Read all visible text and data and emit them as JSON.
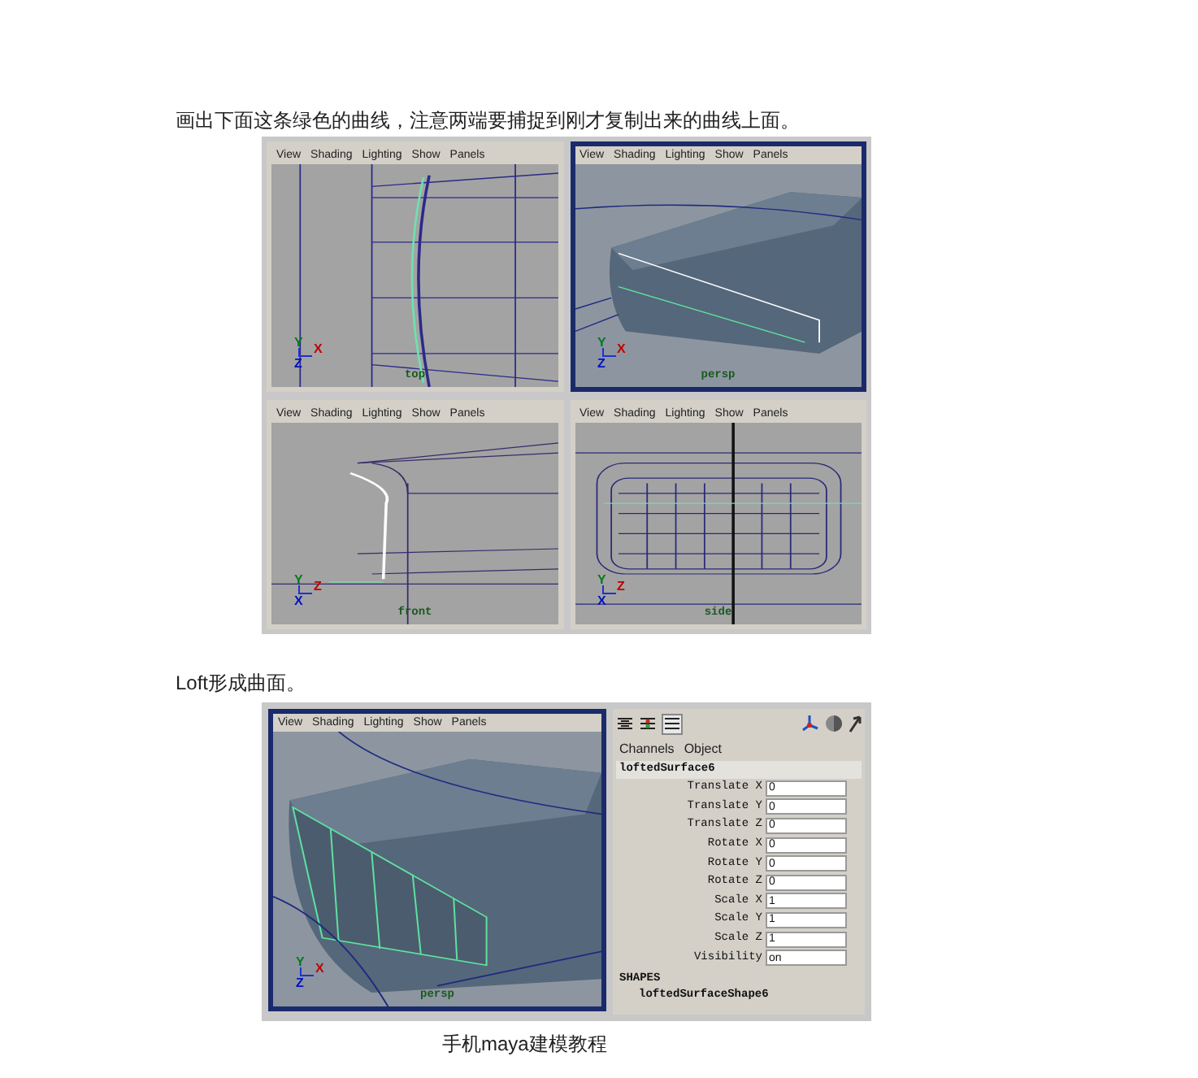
{
  "intro": "画出下面这条绿色的曲线，注意两端要捕捉到刚才复制出来的曲线上面。",
  "figure_1": {
    "viewports": [
      {
        "menu": [
          "View",
          "Shading",
          "Lighting",
          "Show",
          "Panels"
        ],
        "camera": "top",
        "kind": "ortho",
        "selected": false,
        "axes": [
          "Y",
          "X",
          "Z"
        ]
      },
      {
        "menu": [
          "View",
          "Shading",
          "Lighting",
          "Show",
          "Panels"
        ],
        "camera": "persp",
        "kind": "shaded",
        "selected": true,
        "axes": [
          "Y",
          "X",
          "Z"
        ]
      },
      {
        "menu": [
          "View",
          "Shading",
          "Lighting",
          "Show",
          "Panels"
        ],
        "camera": "front",
        "kind": "profile",
        "selected": false,
        "axes": [
          "Y",
          "Z",
          "X"
        ]
      },
      {
        "menu": [
          "View",
          "Shading",
          "Lighting",
          "Show",
          "Panels"
        ],
        "camera": "side",
        "kind": "wire",
        "selected": false,
        "axes": [
          "Y",
          "Z",
          "X"
        ]
      }
    ]
  },
  "text_2": "Loft形成曲面。",
  "figure_2": {
    "viewport": {
      "menu": [
        "View",
        "Shading",
        "Lighting",
        "Show",
        "Panels"
      ],
      "camera": "persp",
      "kind": "lofted",
      "selected": true,
      "axes": [
        "Y",
        "X",
        "Z"
      ]
    },
    "channel_box": {
      "tabs": [
        "Channels",
        "Object"
      ],
      "object": "loftedSurface6",
      "attributes": [
        {
          "name": "Translate X",
          "value": "0"
        },
        {
          "name": "Translate Y",
          "value": "0"
        },
        {
          "name": "Translate Z",
          "value": "0"
        },
        {
          "name": "Rotate X",
          "value": "0"
        },
        {
          "name": "Rotate Y",
          "value": "0"
        },
        {
          "name": "Rotate Z",
          "value": "0"
        },
        {
          "name": "Scale X",
          "value": "1"
        },
        {
          "name": "Scale Y",
          "value": "1"
        },
        {
          "name": "Scale Z",
          "value": "1"
        },
        {
          "name": "Visibility",
          "value": "on"
        }
      ],
      "shapes_heading": "SHAPES",
      "shape": "loftedSurfaceShape6"
    }
  },
  "caption": "手机maya建模教程"
}
